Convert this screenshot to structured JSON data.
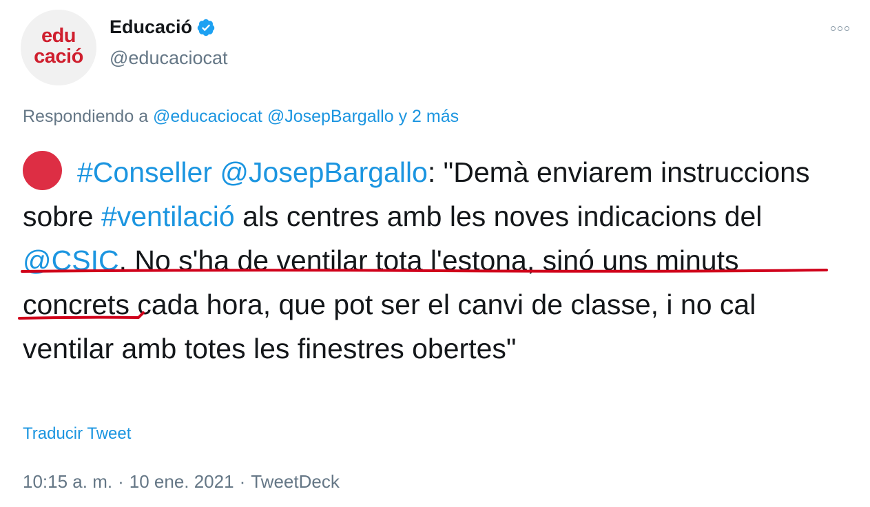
{
  "author": {
    "avatar_line1": "edu",
    "avatar_line2": "cació",
    "display_name": "Educació",
    "handle": "@educaciocat",
    "verified": true,
    "brand_color": "#cf1f2e"
  },
  "reply": {
    "prefix": "Respondiendo a",
    "mention1": "@educaciocat",
    "mention2": "@JosepBargallo",
    "suffix": "y 2 más"
  },
  "tweet": {
    "emoji_icon": "red-circle-icon",
    "hashtag1": "#Conseller",
    "mention_author": "@JosepBargallo",
    "text1": ": \"Demà enviarem instruccions sobre ",
    "hashtag2": "#ventilació",
    "text2": " als centres amb les noves indicacions del ",
    "mention_csic": "@CSIC",
    "text3": ". No s'ha de ventilar tota l'estona, sinó uns minuts concrets cada hora, que pot ser el canvi de classe, i no cal ventilar amb totes les finestres obertes\""
  },
  "translate_label": "Traducir Tweet",
  "meta": {
    "time": "10:15 a. m.",
    "date": "10 ene. 2021",
    "source": "TweetDeck",
    "separator": "·"
  },
  "colors": {
    "link": "#1b95e0",
    "muted": "#657786",
    "text": "#14171a",
    "underline": "#d0021b",
    "verified": "#1da1f2"
  }
}
